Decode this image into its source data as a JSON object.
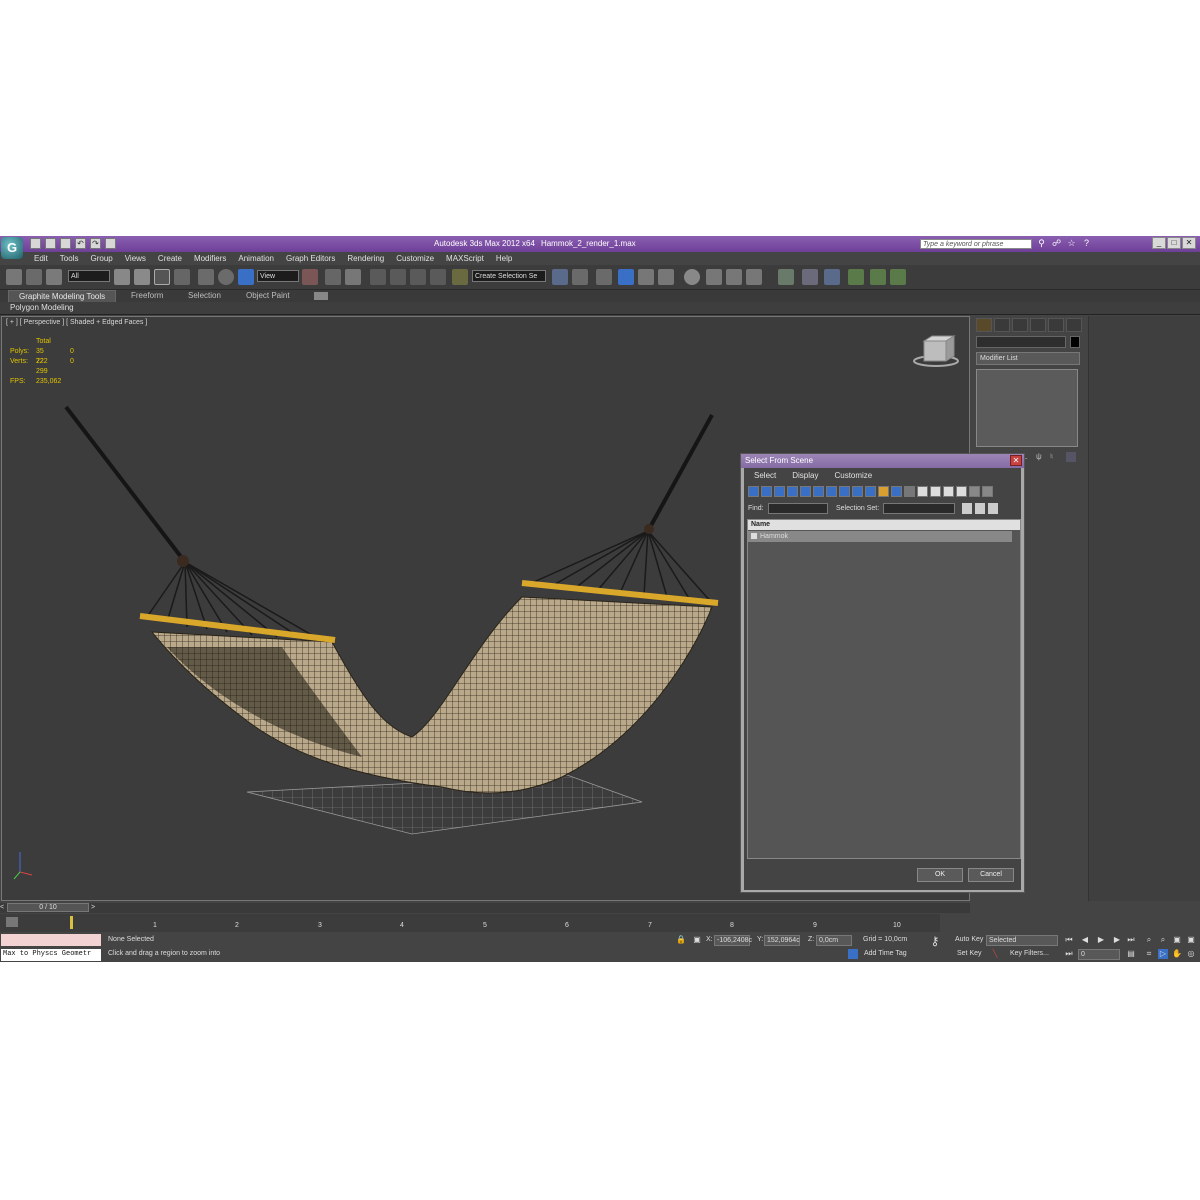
{
  "window": {
    "app_title": "Autodesk 3ds Max  2012 x64",
    "file_name": "Hammok_2_render_1.max",
    "search_placeholder": "Type a keyword or phrase"
  },
  "menu": [
    "Edit",
    "Tools",
    "Group",
    "Views",
    "Create",
    "Modifiers",
    "Animation",
    "Graph Editors",
    "Rendering",
    "Customize",
    "MAXScript",
    "Help"
  ],
  "toolbar": {
    "selection_filter": "All",
    "ref_coord": "View",
    "named_selection": "Create Selection Se"
  },
  "ribbon": {
    "tabs": [
      "Graphite Modeling Tools",
      "Freeform",
      "Selection",
      "Object Paint"
    ],
    "panel": "Polygon Modeling"
  },
  "viewport": {
    "label": "[ + ] [ Perspective ] [ Shaded + Edged Faces ]",
    "stats_header": "Total",
    "polys_label": "Polys:",
    "polys_total": "35 722",
    "polys_sel": "0",
    "verts_label": "Verts:",
    "verts_total": "22 299",
    "verts_sel": "0",
    "fps_label": "FPS:",
    "fps_value": "235,062"
  },
  "command_panel": {
    "modifier_list": "Modifier List"
  },
  "dialog": {
    "title": "Select From Scene",
    "menu": [
      "Select",
      "Display",
      "Customize"
    ],
    "find_label": "Find:",
    "selection_set_label": "Selection Set:",
    "column_name": "Name",
    "items": [
      "Hammok"
    ],
    "ok": "OK",
    "cancel": "Cancel"
  },
  "timeline": {
    "slider": "0 / 10",
    "ticks": [
      "1",
      "2",
      "3",
      "4",
      "5",
      "6",
      "7",
      "8",
      "9",
      "10"
    ]
  },
  "status": {
    "listener_text": "Max to Physcs Geometr",
    "selection_status": "None Selected",
    "prompt": "Click and drag a region to zoom into",
    "x_label": "X:",
    "x_value": "-106,2408c",
    "y_label": "Y:",
    "y_value": "152,0964c",
    "z_label": "Z:",
    "z_value": "0,0cm",
    "grid": "Grid = 10,0cm",
    "add_time_tag": "Add Time Tag",
    "auto_key": "Auto Key",
    "set_key": "Set Key",
    "key_mode": "Selected",
    "key_filters": "Key Filters...",
    "frame": "0"
  },
  "colors": {
    "title_bar": "#7a4ea3",
    "viewport_bg": "#3c3c3c",
    "stats_text": "#e2c400",
    "hammock_bar": "#d9a82a"
  }
}
